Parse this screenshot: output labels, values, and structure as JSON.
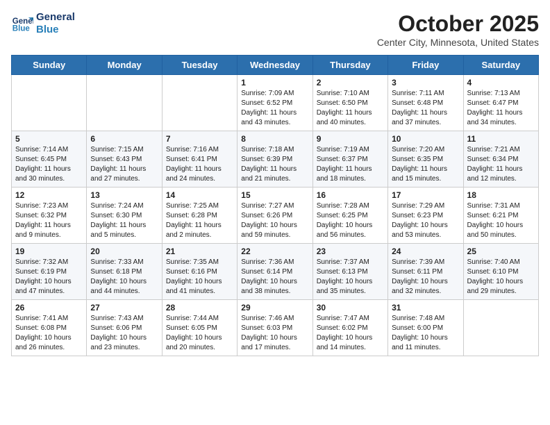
{
  "logo": {
    "line1": "General",
    "line2": "Blue"
  },
  "title": "October 2025",
  "location": "Center City, Minnesota, United States",
  "days_header": [
    "Sunday",
    "Monday",
    "Tuesday",
    "Wednesday",
    "Thursday",
    "Friday",
    "Saturday"
  ],
  "weeks": [
    [
      {
        "day": "",
        "sunrise": "",
        "sunset": "",
        "daylight": ""
      },
      {
        "day": "",
        "sunrise": "",
        "sunset": "",
        "daylight": ""
      },
      {
        "day": "",
        "sunrise": "",
        "sunset": "",
        "daylight": ""
      },
      {
        "day": "1",
        "sunrise": "Sunrise: 7:09 AM",
        "sunset": "Sunset: 6:52 PM",
        "daylight": "Daylight: 11 hours and 43 minutes."
      },
      {
        "day": "2",
        "sunrise": "Sunrise: 7:10 AM",
        "sunset": "Sunset: 6:50 PM",
        "daylight": "Daylight: 11 hours and 40 minutes."
      },
      {
        "day": "3",
        "sunrise": "Sunrise: 7:11 AM",
        "sunset": "Sunset: 6:48 PM",
        "daylight": "Daylight: 11 hours and 37 minutes."
      },
      {
        "day": "4",
        "sunrise": "Sunrise: 7:13 AM",
        "sunset": "Sunset: 6:47 PM",
        "daylight": "Daylight: 11 hours and 34 minutes."
      }
    ],
    [
      {
        "day": "5",
        "sunrise": "Sunrise: 7:14 AM",
        "sunset": "Sunset: 6:45 PM",
        "daylight": "Daylight: 11 hours and 30 minutes."
      },
      {
        "day": "6",
        "sunrise": "Sunrise: 7:15 AM",
        "sunset": "Sunset: 6:43 PM",
        "daylight": "Daylight: 11 hours and 27 minutes."
      },
      {
        "day": "7",
        "sunrise": "Sunrise: 7:16 AM",
        "sunset": "Sunset: 6:41 PM",
        "daylight": "Daylight: 11 hours and 24 minutes."
      },
      {
        "day": "8",
        "sunrise": "Sunrise: 7:18 AM",
        "sunset": "Sunset: 6:39 PM",
        "daylight": "Daylight: 11 hours and 21 minutes."
      },
      {
        "day": "9",
        "sunrise": "Sunrise: 7:19 AM",
        "sunset": "Sunset: 6:37 PM",
        "daylight": "Daylight: 11 hours and 18 minutes."
      },
      {
        "day": "10",
        "sunrise": "Sunrise: 7:20 AM",
        "sunset": "Sunset: 6:35 PM",
        "daylight": "Daylight: 11 hours and 15 minutes."
      },
      {
        "day": "11",
        "sunrise": "Sunrise: 7:21 AM",
        "sunset": "Sunset: 6:34 PM",
        "daylight": "Daylight: 11 hours and 12 minutes."
      }
    ],
    [
      {
        "day": "12",
        "sunrise": "Sunrise: 7:23 AM",
        "sunset": "Sunset: 6:32 PM",
        "daylight": "Daylight: 11 hours and 9 minutes."
      },
      {
        "day": "13",
        "sunrise": "Sunrise: 7:24 AM",
        "sunset": "Sunset: 6:30 PM",
        "daylight": "Daylight: 11 hours and 5 minutes."
      },
      {
        "day": "14",
        "sunrise": "Sunrise: 7:25 AM",
        "sunset": "Sunset: 6:28 PM",
        "daylight": "Daylight: 11 hours and 2 minutes."
      },
      {
        "day": "15",
        "sunrise": "Sunrise: 7:27 AM",
        "sunset": "Sunset: 6:26 PM",
        "daylight": "Daylight: 10 hours and 59 minutes."
      },
      {
        "day": "16",
        "sunrise": "Sunrise: 7:28 AM",
        "sunset": "Sunset: 6:25 PM",
        "daylight": "Daylight: 10 hours and 56 minutes."
      },
      {
        "day": "17",
        "sunrise": "Sunrise: 7:29 AM",
        "sunset": "Sunset: 6:23 PM",
        "daylight": "Daylight: 10 hours and 53 minutes."
      },
      {
        "day": "18",
        "sunrise": "Sunrise: 7:31 AM",
        "sunset": "Sunset: 6:21 PM",
        "daylight": "Daylight: 10 hours and 50 minutes."
      }
    ],
    [
      {
        "day": "19",
        "sunrise": "Sunrise: 7:32 AM",
        "sunset": "Sunset: 6:19 PM",
        "daylight": "Daylight: 10 hours and 47 minutes."
      },
      {
        "day": "20",
        "sunrise": "Sunrise: 7:33 AM",
        "sunset": "Sunset: 6:18 PM",
        "daylight": "Daylight: 10 hours and 44 minutes."
      },
      {
        "day": "21",
        "sunrise": "Sunrise: 7:35 AM",
        "sunset": "Sunset: 6:16 PM",
        "daylight": "Daylight: 10 hours and 41 minutes."
      },
      {
        "day": "22",
        "sunrise": "Sunrise: 7:36 AM",
        "sunset": "Sunset: 6:14 PM",
        "daylight": "Daylight: 10 hours and 38 minutes."
      },
      {
        "day": "23",
        "sunrise": "Sunrise: 7:37 AM",
        "sunset": "Sunset: 6:13 PM",
        "daylight": "Daylight: 10 hours and 35 minutes."
      },
      {
        "day": "24",
        "sunrise": "Sunrise: 7:39 AM",
        "sunset": "Sunset: 6:11 PM",
        "daylight": "Daylight: 10 hours and 32 minutes."
      },
      {
        "day": "25",
        "sunrise": "Sunrise: 7:40 AM",
        "sunset": "Sunset: 6:10 PM",
        "daylight": "Daylight: 10 hours and 29 minutes."
      }
    ],
    [
      {
        "day": "26",
        "sunrise": "Sunrise: 7:41 AM",
        "sunset": "Sunset: 6:08 PM",
        "daylight": "Daylight: 10 hours and 26 minutes."
      },
      {
        "day": "27",
        "sunrise": "Sunrise: 7:43 AM",
        "sunset": "Sunset: 6:06 PM",
        "daylight": "Daylight: 10 hours and 23 minutes."
      },
      {
        "day": "28",
        "sunrise": "Sunrise: 7:44 AM",
        "sunset": "Sunset: 6:05 PM",
        "daylight": "Daylight: 10 hours and 20 minutes."
      },
      {
        "day": "29",
        "sunrise": "Sunrise: 7:46 AM",
        "sunset": "Sunset: 6:03 PM",
        "daylight": "Daylight: 10 hours and 17 minutes."
      },
      {
        "day": "30",
        "sunrise": "Sunrise: 7:47 AM",
        "sunset": "Sunset: 6:02 PM",
        "daylight": "Daylight: 10 hours and 14 minutes."
      },
      {
        "day": "31",
        "sunrise": "Sunrise: 7:48 AM",
        "sunset": "Sunset: 6:00 PM",
        "daylight": "Daylight: 10 hours and 11 minutes."
      },
      {
        "day": "",
        "sunrise": "",
        "sunset": "",
        "daylight": ""
      }
    ]
  ]
}
